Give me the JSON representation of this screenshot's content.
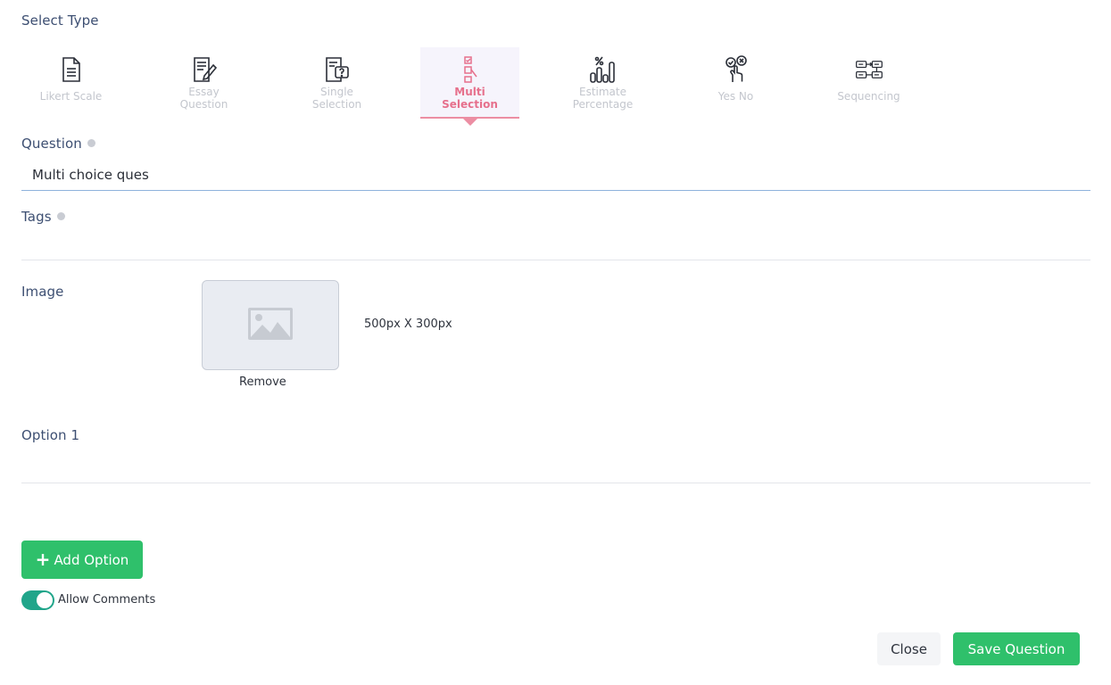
{
  "select_type": {
    "heading": "Select Type",
    "types": [
      {
        "line1": "Likert Scale",
        "line2": "",
        "icon": "document-list-icon"
      },
      {
        "line1": "Essay",
        "line2": "Question",
        "icon": "document-pen-icon"
      },
      {
        "line1": "Single",
        "line2": "Selection",
        "icon": "document-question-icon"
      },
      {
        "line1": "Multi",
        "line2": "Selection",
        "icon": "checkbox-list-icon"
      },
      {
        "line1": "Estimate",
        "line2": "Percentage",
        "icon": "percent-bars-icon"
      },
      {
        "line1": "Yes No",
        "line2": "",
        "icon": "check-cross-hand-icon"
      },
      {
        "line1": "Sequencing",
        "line2": "",
        "icon": "sequence-flow-icon"
      }
    ],
    "active_index": 3
  },
  "question": {
    "label": "Question",
    "value": "Multi choice ques"
  },
  "tags": {
    "label": "Tags",
    "value": ""
  },
  "image": {
    "label": "Image",
    "size_text": "500px X 300px",
    "remove_label": "Remove"
  },
  "option": {
    "label": "Option 1",
    "value": ""
  },
  "add_option_label": "Add Option",
  "add_option_plus": "+",
  "allow_comments": {
    "label": "Allow Comments",
    "enabled": true
  },
  "footer": {
    "close_label": "Close",
    "save_label": "Save Question"
  },
  "colors": {
    "active_pink": "#e6708c",
    "green": "#2fc06b",
    "toggle_teal": "#20a58a"
  }
}
